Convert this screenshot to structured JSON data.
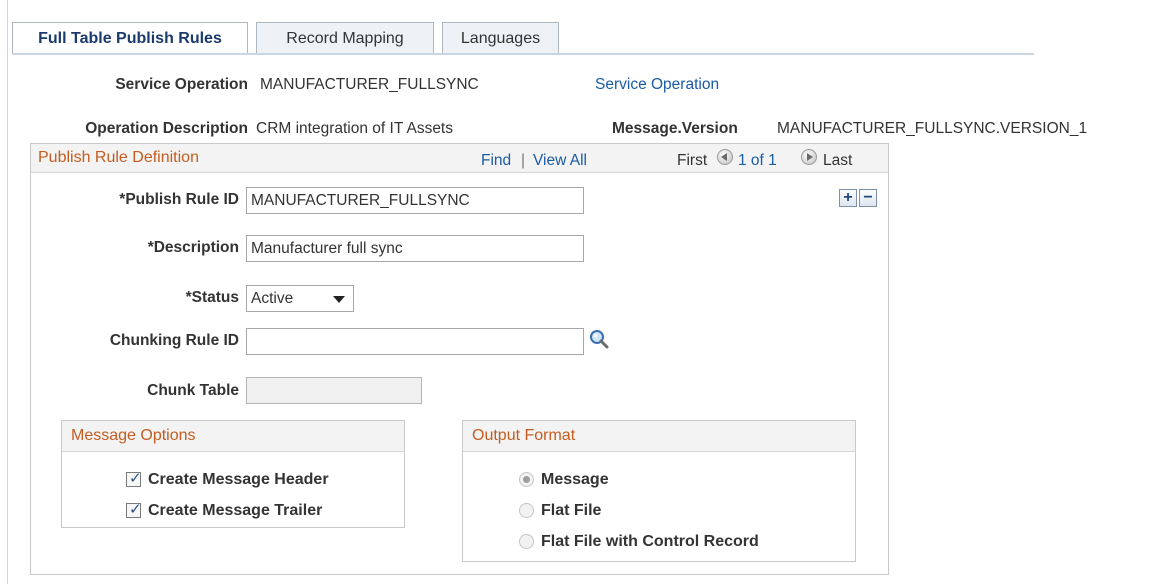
{
  "tabs": [
    {
      "label": "Full Table Publish Rules",
      "active": true
    },
    {
      "label": "Record Mapping",
      "active": false
    },
    {
      "label": "Languages",
      "active": false
    }
  ],
  "header": {
    "service_operation_label": "Service Operation",
    "service_operation_value": "MANUFACTURER_FULLSYNC",
    "service_operation_link": "Service Operation",
    "operation_description_label": "Operation Description",
    "operation_description_value": "CRM integration of IT Assets",
    "message_version_label": "Message.Version",
    "message_version_value": "MANUFACTURER_FULLSYNC.VERSION_1"
  },
  "publish_rule": {
    "title": "Publish Rule Definition",
    "nav": {
      "find": "Find",
      "separator": "|",
      "view_all": "View All",
      "first": "First",
      "page_info": "1 of 1",
      "last": "Last"
    },
    "publish_rule_id_label": "*Publish Rule ID",
    "publish_rule_id_value": "MANUFACTURER_FULLSYNC",
    "description_label": "*Description",
    "description_value": "Manufacturer full sync",
    "status_label": "*Status",
    "status_value": "Active",
    "chunking_rule_id_label": "Chunking Rule ID",
    "chunking_rule_id_value": "",
    "chunk_table_label": "Chunk Table",
    "chunk_table_value": "",
    "add_symbol": "+",
    "remove_symbol": "−"
  },
  "message_options": {
    "title": "Message Options",
    "items": [
      {
        "label": "Create Message Header",
        "checked": true
      },
      {
        "label": "Create Message Trailer",
        "checked": true
      }
    ]
  },
  "output_format": {
    "title": "Output Format",
    "options": [
      {
        "label": "Message",
        "selected": true
      },
      {
        "label": "Flat File",
        "selected": false
      },
      {
        "label": "Flat File with Control Record",
        "selected": false
      }
    ]
  },
  "icons": {
    "lookup": "magnifier-icon",
    "prev": "previous-arrow-icon",
    "next": "next-arrow-icon",
    "checkmark": "✓"
  },
  "colors": {
    "section_title": "#c45d21",
    "link": "#1a5ba6",
    "active_tab_text": "#1c3b6d"
  }
}
